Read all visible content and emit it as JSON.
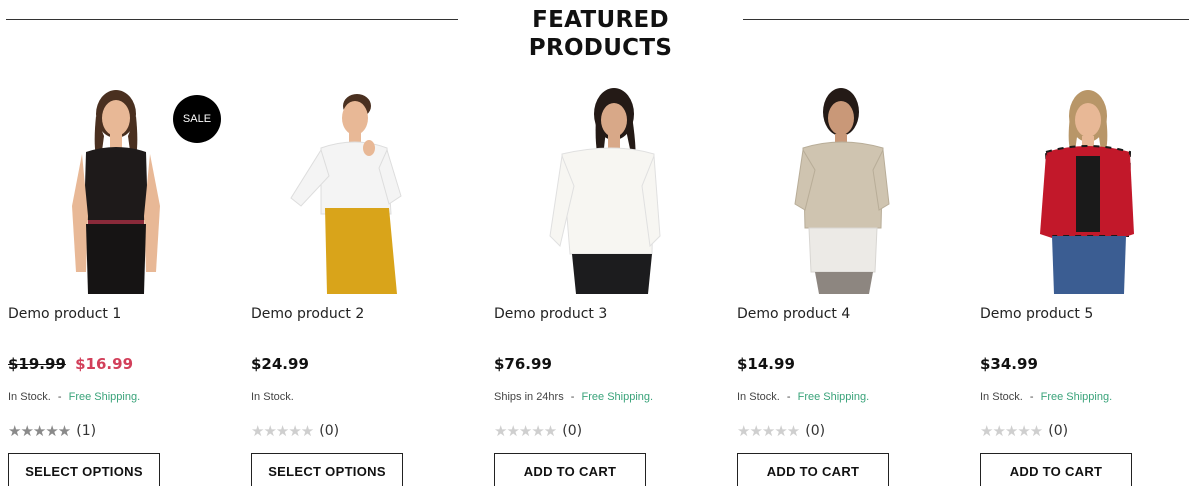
{
  "section": {
    "title": "FEATURED PRODUCTS"
  },
  "colors": {
    "sale_price": "#d23f5a",
    "free_shipping": "#3aa37a",
    "badge_bg": "#000000"
  },
  "products": [
    {
      "name": "Demo product 1",
      "badge": "SALE",
      "old_price": "$19.99",
      "price": "$16.99",
      "stock": "In Stock.",
      "separator": "-",
      "shipping": "Free Shipping.",
      "stars": "★★★★★",
      "rating_count": "(1)",
      "button": "SELECT OPTIONS"
    },
    {
      "name": "Demo product 2",
      "price": "$24.99",
      "stock": "In Stock.",
      "stars": "★★★★★",
      "rating_count": "(0)",
      "button": "SELECT OPTIONS"
    },
    {
      "name": "Demo product 3",
      "price": "$76.99",
      "stock": "Ships in 24hrs",
      "separator": "-",
      "shipping": "Free Shipping.",
      "stars": "★★★★★",
      "rating_count": "(0)",
      "button": "ADD TO CART"
    },
    {
      "name": "Demo product 4",
      "price": "$14.99",
      "stock": "In Stock.",
      "separator": "-",
      "shipping": "Free Shipping.",
      "stars": "★★★★★",
      "rating_count": "(0)",
      "button": "ADD TO CART"
    },
    {
      "name": "Demo product 5",
      "price": "$34.99",
      "stock": "In Stock.",
      "separator": "-",
      "shipping": "Free Shipping.",
      "stars": "★★★★★",
      "rating_count": "(0)",
      "button": "ADD TO CART"
    }
  ]
}
